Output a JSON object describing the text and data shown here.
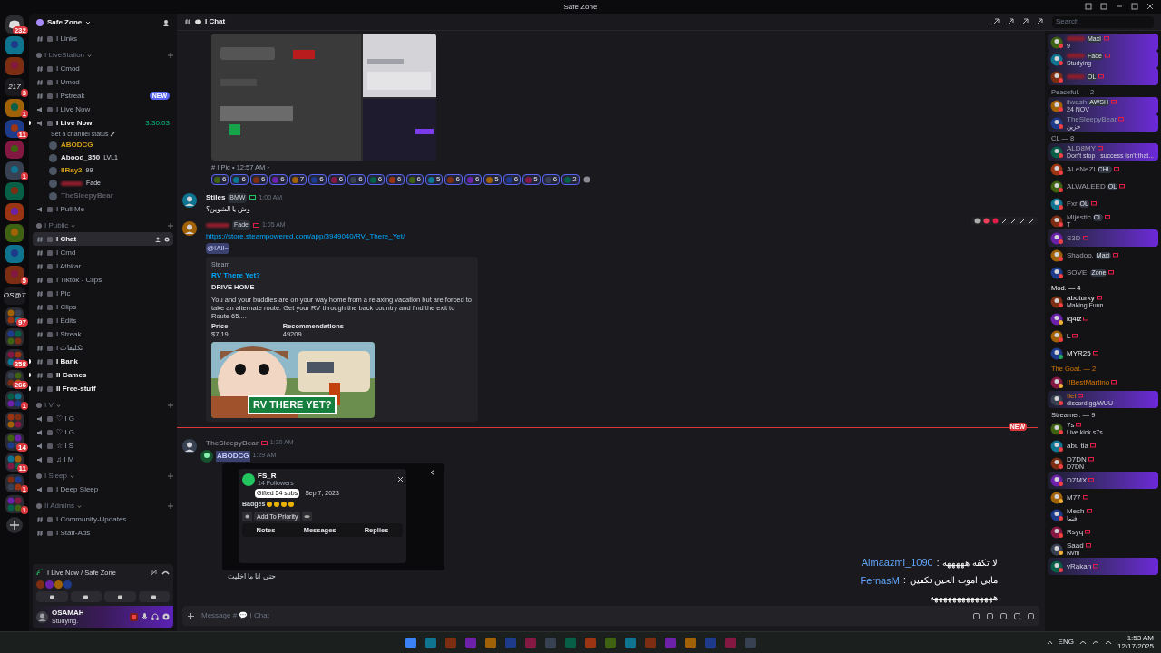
{
  "window": {
    "title": "Safe Zone"
  },
  "servers": [
    {
      "kind": "discord",
      "badge": "232"
    },
    {
      "kind": "icon"
    },
    {
      "kind": "icon"
    },
    {
      "kind": "text",
      "label": "217",
      "badge": "3"
    },
    {
      "kind": "icon",
      "badge": "1"
    },
    {
      "kind": "icon",
      "badge": "11"
    },
    {
      "kind": "icon"
    },
    {
      "kind": "icon",
      "badge": "1"
    },
    {
      "kind": "icon"
    },
    {
      "kind": "icon"
    },
    {
      "kind": "icon"
    },
    {
      "kind": "icon"
    },
    {
      "kind": "icon",
      "badge": "5"
    },
    {
      "kind": "text",
      "label": "OS@T"
    },
    {
      "kind": "folder",
      "badge": "97"
    },
    {
      "kind": "folder"
    },
    {
      "kind": "folder",
      "badge": "258"
    },
    {
      "kind": "folder",
      "badge": "266"
    },
    {
      "kind": "folder",
      "badge": "1"
    },
    {
      "kind": "folder"
    },
    {
      "kind": "folder",
      "badge": "14"
    },
    {
      "kind": "folder",
      "badge": "11"
    },
    {
      "kind": "folder",
      "badge": "1"
    },
    {
      "kind": "folder",
      "badge": "1"
    },
    {
      "kind": "add"
    }
  ],
  "server_name": "Safe Zone",
  "channels": [
    {
      "kind": "text",
      "name": "I Links",
      "selected": false,
      "unread": false
    },
    {
      "kind": "category",
      "name": "I LiveStation",
      "children": [
        {
          "kind": "text",
          "name": "I Cmod",
          "selected": false,
          "unread": false
        },
        {
          "kind": "text",
          "name": "I Umod",
          "selected": false,
          "unread": false
        },
        {
          "kind": "text",
          "name": "I Pstreak",
          "selected": false,
          "unread": false,
          "badge": "NEW"
        },
        {
          "kind": "voice",
          "name": "I Live Now",
          "selected": false,
          "unread": false
        },
        {
          "kind": "voice",
          "name": "I Live Now",
          "selected": false,
          "unread": true,
          "time": "3:30:03",
          "status_text": "Set a channel status",
          "children": [
            {
              "kind": "vip",
              "name": "ABODCG"
            },
            {
              "kind": "regular",
              "name": "Abood_350",
              "tag": "LVL1"
            },
            {
              "kind": "vip",
              "name": "IIRay2",
              "tag": "99"
            },
            {
              "kind": "owner",
              "tag": "Fade"
            },
            {
              "kind": "faded",
              "name": "TheSleepyBear"
            }
          ]
        },
        {
          "kind": "voice",
          "name": "I Pull Me",
          "selected": false,
          "unread": false
        }
      ]
    },
    {
      "kind": "category",
      "name": "I Public",
      "children": [
        {
          "kind": "text",
          "name": "I Chat",
          "selected": true,
          "unread": false
        },
        {
          "kind": "text",
          "name": "I Cmd",
          "selected": false,
          "unread": false
        },
        {
          "kind": "text",
          "name": "I Athkar",
          "selected": false,
          "unread": false
        },
        {
          "kind": "text",
          "name": "I Tiktok - Clips",
          "selected": false,
          "unread": false
        },
        {
          "kind": "text",
          "name": "I Pic",
          "selected": false,
          "unread": false
        },
        {
          "kind": "text",
          "name": "I Clips",
          "selected": false,
          "unread": false
        },
        {
          "kind": "text",
          "name": "I Edits",
          "selected": false,
          "unread": false
        },
        {
          "kind": "text",
          "name": "I Streak",
          "selected": false,
          "unread": false
        },
        {
          "kind": "text",
          "name": "I تكليفات",
          "selected": false,
          "unread": false
        },
        {
          "kind": "text",
          "name": "I Bank",
          "selected": false,
          "unread": true
        },
        {
          "kind": "text",
          "name": "II Games",
          "selected": false,
          "unread": true
        },
        {
          "kind": "text",
          "name": "II Free-stuff",
          "selected": false,
          "unread": true
        }
      ]
    },
    {
      "kind": "category",
      "name": "I V",
      "children": [
        {
          "kind": "voice",
          "name": "♡ I G",
          "selected": false,
          "unread": false
        },
        {
          "kind": "voice",
          "name": "♡ I G",
          "selected": false,
          "unread": false
        },
        {
          "kind": "voice",
          "name": "☆ I S",
          "selected": false,
          "unread": false
        },
        {
          "kind": "voice",
          "name": "♫ I M",
          "selected": false,
          "unread": false
        }
      ]
    },
    {
      "kind": "category",
      "name": "I Sleep",
      "children": [
        {
          "kind": "voice",
          "name": "I Deep Sleep",
          "selected": false,
          "unread": false
        }
      ]
    },
    {
      "kind": "category",
      "name": "II Admins",
      "children": [
        {
          "kind": "text",
          "name": "I Community-Updates",
          "selected": false,
          "unread": false
        },
        {
          "kind": "text",
          "name": "I Staff-Ads",
          "selected": false,
          "unread": false
        }
      ]
    }
  ],
  "voice_panel": {
    "channel": "I Live Now / Safe Zone"
  },
  "user": {
    "name": "OSAMAH",
    "status": "Studying."
  },
  "channel_header": {
    "name": "I Chat",
    "search_placeholder": "Search"
  },
  "forward_footer": "# I Pic • 12:57 AM ›",
  "reactions": [
    {
      "count": "6"
    },
    {
      "count": "6"
    },
    {
      "count": "6"
    },
    {
      "count": "6"
    },
    {
      "count": "7"
    },
    {
      "count": "6"
    },
    {
      "count": "6"
    },
    {
      "count": "6"
    },
    {
      "count": "6"
    },
    {
      "count": "6"
    },
    {
      "count": "6"
    },
    {
      "count": "5"
    },
    {
      "count": "6"
    },
    {
      "count": "6"
    },
    {
      "count": "5"
    },
    {
      "count": "6"
    },
    {
      "count": "5"
    },
    {
      "count": "6"
    },
    {
      "count": "2"
    }
  ],
  "messages": [
    {
      "author": "Stiles",
      "tag": "BMW",
      "time": "1:00 AM",
      "text": "وش يا الشوين؟"
    },
    {
      "tag": "Fade",
      "time": "1:05 AM",
      "link": "https://store.steampowered.com/app/3949040/RV_There_Yet/",
      "mention": "@!All~",
      "embed": {
        "provider": "Steam",
        "title": "RV There Yet?",
        "subtitle": "DRIVE HOME",
        "description": "You and your buddies are on your way home from a relaxing vacation but are forced to take an alternate route. Get your RV through the back country and find the exit to Route 65....",
        "fields": [
          {
            "name": "Price",
            "value": "$7.19"
          },
          {
            "name": "Recommendations",
            "value": "49209"
          }
        ],
        "image_title": "RV THERE YET?"
      }
    },
    {
      "author": "TheSleepyBear",
      "time": "1:30 AM",
      "new_divider": "NEW",
      "forwarded": {
        "author": "ABODCG",
        "time": "1:29 AM",
        "card": {
          "name": "FS_R",
          "followers": "14 Followers",
          "tooltip": "Gifted 54 subs",
          "joined": "Sep 7, 2023",
          "badges_label": "Badges",
          "action": "Add To Priority",
          "tabs": [
            "Notes",
            "Messages",
            "Replies"
          ]
        },
        "caption": "حتى انا ما اخليت"
      }
    }
  ],
  "composer": {
    "placeholder": "Message # 💬 I Chat"
  },
  "stream_overlay": [
    {
      "name": "Almaazmi_1090",
      "separator": ":",
      "text": "لا تكفه هههههه"
    },
    {
      "name": "FernasM",
      "separator": ":",
      "text": "مابي اموت الحين تكفين"
    },
    {
      "text": "ههههههههههههههه"
    }
  ],
  "member_groups": [
    {
      "kind": "owner",
      "members": [
        {
          "tag": "Maxi",
          "activity": "9",
          "color": "#f23f43",
          "banner": true
        },
        {
          "tag": "Fade",
          "activity": "Studying",
          "color": "#f23f43",
          "banner": true
        },
        {
          "tag": "OL",
          "color": "#f23f43",
          "banner": true
        }
      ]
    },
    {
      "kind": "peaceful",
      "title": "Peaceful. — 2",
      "members": [
        {
          "name": "ilwash",
          "tag": "AWSH",
          "activity": "24 NOV",
          "color": "#f23f43",
          "banner": true
        },
        {
          "name": "TheSleepyBear",
          "activity": "حزين",
          "color": "#f23f43",
          "banner": true
        }
      ]
    },
    {
      "kind": "cl",
      "title": "CL — 8",
      "members": [
        {
          "name": "ALD8MY",
          "activity": "Don't stop , success isn't that...",
          "color": "#f23f43",
          "banner": true
        },
        {
          "name": "ALeNeZI",
          "tag": "CHL",
          "color": "#f23f43",
          "banner": false
        },
        {
          "name": "ALWALEED",
          "tag": "OL",
          "color": "#f23f43",
          "banner": false
        },
        {
          "name": "Fxr",
          "tag": "OL",
          "color": "#f23f43",
          "banner": false
        },
        {
          "name": "Mijestic",
          "tag": "OL",
          "activity": "T",
          "color": "#f23f43",
          "banner": false
        },
        {
          "name": "S3D",
          "color": "#f23f43",
          "banner": true
        },
        {
          "name": "Shadoo.",
          "tag": "Maxi",
          "color": "#f23f43",
          "banner": false
        },
        {
          "name": "SOVE.",
          "tag": "Zone",
          "color": "#f23f43",
          "banner": false
        }
      ]
    },
    {
      "kind": "mod",
      "title": "Mod. — 4",
      "members": [
        {
          "name": "aboturky",
          "activity": "Making Fuun",
          "color": "#f23f43",
          "banner": false
        },
        {
          "name": "lq4lz",
          "color": "#f0b232",
          "banner": false
        },
        {
          "name": "L",
          "color": "#f23f43",
          "banner": false
        },
        {
          "name": "MYR25",
          "color": "#23a55a",
          "banner": false
        }
      ]
    },
    {
      "kind": "goat",
      "title": "The Goat. — 2",
      "members": [
        {
          "name": "!!BestMartino",
          "color": "#f0b232",
          "banner": false
        },
        {
          "name": "Ilel",
          "activity": "discord.gg/WUU",
          "color": "#f23f43",
          "banner": true
        }
      ]
    },
    {
      "kind": "streamer",
      "title": "Streamer. — 9",
      "members": [
        {
          "name": "7s",
          "activity": "Live kick s7s",
          "color": "#f23f43",
          "banner": false
        },
        {
          "name": "abu tia",
          "color": "#f23f43",
          "banner": false
        },
        {
          "name": "D7DN",
          "activity": "D7DN",
          "color": "#f23f43",
          "banner": false
        },
        {
          "name": "D7MX",
          "color": "#f23f43",
          "banner": true
        },
        {
          "name": "M77",
          "color": "#f0b232",
          "banner": false
        },
        {
          "name": "Mesh",
          "activity": "فنما",
          "color": "#f23f43",
          "banner": false
        },
        {
          "name": "Rsyq",
          "color": "#f23f43",
          "banner": false
        },
        {
          "name": "Saad",
          "activity": "Nvm",
          "color": "#f0b232",
          "banner": false
        },
        {
          "name": "vRakan",
          "color": "#f23f43",
          "banner": true
        }
      ]
    }
  ],
  "taskbar": {
    "language": "ENG",
    "time": "1:53 AM",
    "date": "12/17/2025"
  }
}
